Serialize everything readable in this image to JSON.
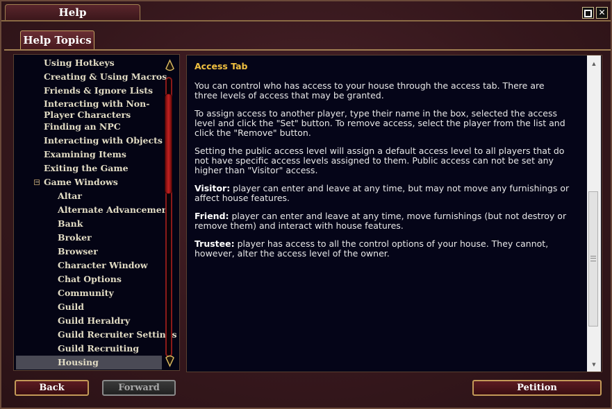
{
  "window": {
    "title": "Help"
  },
  "tabs": {
    "help_topics": "Help Topics"
  },
  "topics": [
    {
      "label": "Using Hotkeys",
      "level": 1
    },
    {
      "label": "Creating & Using Macros",
      "level": 1
    },
    {
      "label": "Friends & Ignore Lists",
      "level": 1
    },
    {
      "label": "Interacting with Non-Player Characters",
      "level": 1
    },
    {
      "label": "Finding an NPC",
      "level": 1
    },
    {
      "label": "Interacting with Objects",
      "level": 1
    },
    {
      "label": "Examining Items",
      "level": 1
    },
    {
      "label": "Exiting the Game",
      "level": 1
    },
    {
      "label": "Game Windows",
      "level": 1,
      "expand_glyph": "−"
    },
    {
      "label": "Altar",
      "level": 2
    },
    {
      "label": "Alternate Advancement",
      "level": 2
    },
    {
      "label": "Bank",
      "level": 2
    },
    {
      "label": "Broker",
      "level": 2
    },
    {
      "label": "Browser",
      "level": 2
    },
    {
      "label": "Character Window",
      "level": 2
    },
    {
      "label": "Chat Options",
      "level": 2
    },
    {
      "label": "Community",
      "level": 2
    },
    {
      "label": "Guild",
      "level": 2
    },
    {
      "label": "Guild Heraldry",
      "level": 2
    },
    {
      "label": "Guild Recruiter Settings",
      "level": 2
    },
    {
      "label": "Guild Recruiting",
      "level": 2
    },
    {
      "label": "Housing",
      "level": 2,
      "selected": true
    }
  ],
  "article": {
    "title": "Access Tab",
    "p1": "You can control who has access to your house through the access tab. There are three levels of access that may be granted.",
    "p2": "To assign access to another player, type their name in the box, selected the access level and click the \"Set\" button. To remove access, select the player from the list and click the \"Remove\" button.",
    "p3": "Setting the public access level will assign a default access level to all players that do not have specific access levels assigned to them. Public access can not be set any higher than \"Visitor\" access.",
    "visitor_label": "Visitor:",
    "visitor_text": " player can enter and leave at any time, but may not move any furnishings or affect house features.",
    "friend_label": "Friend:",
    "friend_text": " player can enter and leave at any time, move furnishings (but not destroy or remove them) and interact with house features.",
    "trustee_label": "Trustee:",
    "trustee_text": " player has access to all the control options of your house. They cannot, however, alter the access level of the owner."
  },
  "buttons": {
    "back": "Back",
    "forward": "Forward",
    "petition": "Petition"
  },
  "window_buttons": {
    "close_glyph": "✕"
  },
  "scroll_arrows": {
    "up": "▲",
    "down": "▼"
  },
  "colors": {
    "accent_gold": "#f0c040",
    "frame": "#c49a58",
    "background": "#35171c"
  }
}
